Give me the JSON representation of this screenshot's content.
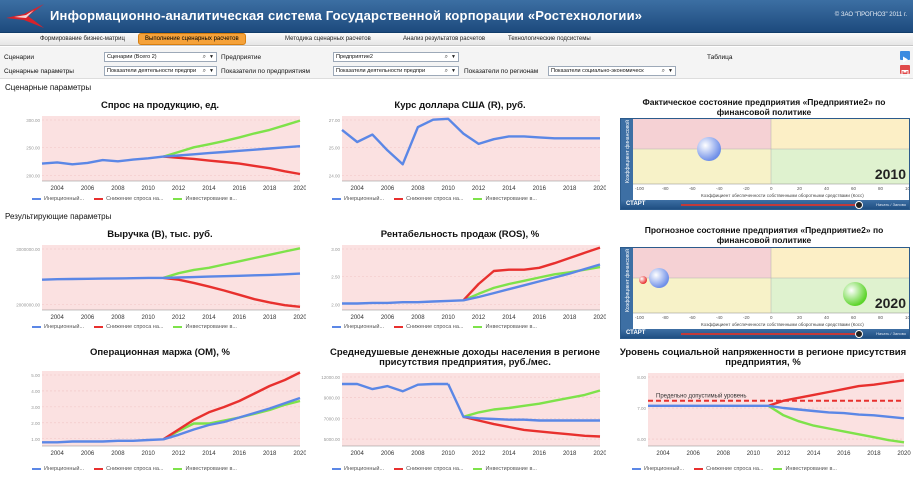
{
  "app": {
    "title": "Информационно-аналитическая система Государственной корпорации «Ростехнологии»",
    "copyright": "© ЗАО \"ПРОГНОЗ\" 2011 г."
  },
  "tabs": [
    {
      "label": "Формирование бизнес-матриц",
      "active": false
    },
    {
      "label": "Выполнение сценарных расчетов",
      "active": true
    },
    {
      "label": "Методика сценарных расчетов",
      "active": false
    },
    {
      "label": "Анализ результатов расчетов",
      "active": false
    },
    {
      "label": "Технологические подсистемы",
      "active": false
    }
  ],
  "filters": {
    "scenarios_label": "Сценарии",
    "scenarios_value": "Сценарии (Всего 2)",
    "enterprise_label": "Предприятие",
    "enterprise_value": "Предприятие2",
    "table_label": "Таблица",
    "scen_params_label": "Сценарные параметры",
    "scen_params_value": "Показатели деятельности предпри",
    "ent_params_label": "Показатели по предприятиям",
    "ent_params_value": "Показатели деятельности предпри",
    "reg_params_label": "Показатели по регионам",
    "reg_params_value": "Показатели социально-экономическ"
  },
  "sections": {
    "scenario": "Сценарные параметры",
    "result": "Результирующие параметры"
  },
  "legend": {
    "inertial": "Инерционный...",
    "decline": "Снижение спроса на...",
    "invest": "Инвестирование в..."
  },
  "colors": {
    "inertial": "#5b87e6",
    "decline": "#e8302e",
    "invest": "#7ee24a",
    "band": "#fbe1e1",
    "grid": "#f1c5c5",
    "header": "#2a5d93",
    "accent": "#f5a23a"
  },
  "chart_data": [
    {
      "id": "demand",
      "type": "line",
      "title": "Спрос на продукцию, ед.",
      "x": [
        2003,
        2004,
        2005,
        2006,
        2007,
        2008,
        2009,
        2010,
        2011,
        2012,
        2013,
        2014,
        2015,
        2016,
        2017,
        2018,
        2019,
        2020
      ],
      "ylim": [
        180,
        460
      ],
      "yticks": [
        "300.00",
        "250.00",
        "200.00"
      ],
      "xticks": [
        2004,
        2006,
        2008,
        2010,
        2012,
        2014,
        2016,
        2018,
        2020
      ],
      "series": [
        {
          "key": "inertial",
          "values": [
            255,
            260,
            252,
            258,
            270,
            265,
            272,
            278,
            285,
            290,
            295,
            300,
            305,
            310,
            315,
            320,
            325,
            330
          ]
        },
        {
          "key": "decline",
          "values": [
            null,
            null,
            null,
            null,
            null,
            null,
            null,
            null,
            285,
            280,
            275,
            268,
            262,
            255,
            245,
            235,
            222,
            210
          ]
        },
        {
          "key": "invest",
          "values": [
            null,
            null,
            null,
            null,
            null,
            null,
            null,
            null,
            285,
            305,
            325,
            338,
            352,
            368,
            385,
            400,
            420,
            440
          ]
        }
      ]
    },
    {
      "id": "usd",
      "type": "line",
      "title": "Курс доллара США (R), руб.",
      "x": [
        2003,
        2004,
        2005,
        2006,
        2007,
        2008,
        2009,
        2010,
        2011,
        2012,
        2013,
        2014,
        2015,
        2016,
        2017,
        2018,
        2019,
        2020
      ],
      "ylim": [
        23,
        30
      ],
      "yticks": [
        "27.00",
        "25.00",
        "24.00"
      ],
      "xticks": [
        2004,
        2006,
        2008,
        2010,
        2012,
        2014,
        2016,
        2018,
        2020
      ],
      "series": [
        {
          "key": "inertial",
          "values": [
            28.5,
            27.2,
            28.0,
            26.3,
            24.8,
            28.8,
            29.6,
            29.7,
            28.1,
            27.0,
            27.5,
            27.8,
            27.8,
            27.7,
            27.6,
            27.6,
            27.6,
            27.6
          ]
        }
      ]
    },
    {
      "id": "revenue",
      "type": "line",
      "title": "Выручка (В), тыс. руб.",
      "x": [
        2003,
        2004,
        2005,
        2006,
        2007,
        2008,
        2009,
        2010,
        2011,
        2012,
        2013,
        2014,
        2015,
        2016,
        2017,
        2018,
        2019,
        2020
      ],
      "ylim": [
        150,
        450
      ],
      "yticks": [
        "3000000.00",
        "2000000.00"
      ],
      "xticks": [
        2004,
        2006,
        2008,
        2010,
        2012,
        2014,
        2016,
        2018,
        2020
      ],
      "series": [
        {
          "key": "inertial",
          "values": [
            290,
            292,
            293,
            294,
            295,
            296,
            297,
            298,
            298,
            300,
            302,
            304,
            306,
            308,
            310,
            312,
            315,
            318
          ]
        },
        {
          "key": "decline",
          "values": [
            null,
            null,
            null,
            null,
            null,
            null,
            null,
            null,
            298,
            290,
            275,
            258,
            240,
            220,
            200,
            185,
            172,
            165
          ]
        },
        {
          "key": "invest",
          "values": [
            null,
            null,
            null,
            null,
            null,
            null,
            null,
            null,
            298,
            320,
            335,
            345,
            360,
            375,
            390,
            405,
            420,
            435
          ]
        }
      ]
    },
    {
      "id": "ros",
      "type": "line",
      "title": "Рентабельность продаж (ROS), %",
      "x": [
        2003,
        2004,
        2005,
        2006,
        2007,
        2008,
        2009,
        2010,
        2011,
        2012,
        2013,
        2014,
        2015,
        2016,
        2017,
        2018,
        2019,
        2020
      ],
      "ylim": [
        0,
        100
      ],
      "yticks": [
        "3.00",
        "2.50",
        "2.00"
      ],
      "xticks": [
        2004,
        2006,
        2008,
        2010,
        2012,
        2014,
        2016,
        2018,
        2020
      ],
      "series": [
        {
          "key": "inertial",
          "values": [
            10,
            10,
            11,
            11,
            12,
            12,
            13,
            14,
            15,
            20,
            26,
            32,
            38,
            44,
            50,
            56,
            63,
            70
          ]
        },
        {
          "key": "decline",
          "values": [
            null,
            null,
            null,
            null,
            null,
            null,
            null,
            null,
            15,
            40,
            60,
            62,
            62,
            65,
            72,
            80,
            88,
            96
          ]
        },
        {
          "key": "invest",
          "values": [
            null,
            null,
            null,
            null,
            null,
            null,
            null,
            null,
            15,
            25,
            34,
            40,
            45,
            50,
            55,
            58,
            62,
            66
          ]
        }
      ]
    },
    {
      "id": "om",
      "type": "line",
      "title": "Операционная маржа (ОМ), %",
      "x": [
        2003,
        2004,
        2005,
        2006,
        2007,
        2008,
        2009,
        2010,
        2011,
        2012,
        2013,
        2014,
        2015,
        2016,
        2017,
        2018,
        2019,
        2020
      ],
      "ylim": [
        0,
        100
      ],
      "yticks": [
        "5.00",
        "4.00",
        "3.00",
        "2.00",
        "1.00"
      ],
      "xticks": [
        2004,
        2006,
        2008,
        2010,
        2012,
        2014,
        2016,
        2018,
        2020
      ],
      "series": [
        {
          "key": "inertial",
          "values": [
            5,
            5,
            6,
            6,
            6,
            7,
            7,
            8,
            9,
            15,
            22,
            28,
            32,
            38,
            44,
            50,
            57,
            64
          ]
        },
        {
          "key": "decline",
          "values": [
            null,
            null,
            null,
            null,
            null,
            null,
            null,
            null,
            9,
            22,
            35,
            45,
            52,
            60,
            70,
            80,
            88,
            98
          ]
        },
        {
          "key": "invest",
          "values": [
            null,
            null,
            null,
            null,
            null,
            null,
            null,
            null,
            9,
            20,
            30,
            30,
            34,
            38,
            43,
            48,
            55,
            60
          ]
        }
      ]
    },
    {
      "id": "income",
      "type": "line",
      "title": "Среднедушевые денежные доходы населения в регионе присутствия предприятия, руб./мес.",
      "x": [
        2003,
        2004,
        2005,
        2006,
        2007,
        2008,
        2009,
        2010,
        2011,
        2012,
        2013,
        2014,
        2015,
        2016,
        2017,
        2018,
        2019,
        2020
      ],
      "ylim": [
        0,
        100
      ],
      "yticks": [
        "12000.00",
        "9000.00",
        "7000.00",
        "5000.00"
      ],
      "xticks": [
        2004,
        2006,
        2008,
        2010,
        2012,
        2014,
        2016,
        2018,
        2020
      ],
      "series": [
        {
          "key": "inertial",
          "values": [
            85,
            85,
            78,
            82,
            75,
            84,
            85,
            85,
            null,
            null,
            null,
            null,
            null,
            null,
            null,
            null,
            null,
            null
          ]
        },
        {
          "key": "inertial",
          "values": [
            null,
            null,
            null,
            null,
            null,
            null,
            null,
            85,
            40,
            38,
            37,
            36,
            36,
            35,
            35,
            35,
            35,
            35
          ]
        },
        {
          "key": "decline",
          "values": [
            null,
            null,
            null,
            null,
            null,
            null,
            null,
            null,
            40,
            35,
            30,
            26,
            22,
            20,
            18,
            16,
            14,
            13
          ]
        },
        {
          "key": "invest",
          "values": [
            null,
            null,
            null,
            null,
            null,
            null,
            null,
            null,
            40,
            46,
            50,
            52,
            55,
            58,
            62,
            66,
            70,
            76
          ]
        }
      ]
    },
    {
      "id": "tension",
      "type": "line",
      "title": "Уровень социальной напряженности в регионе присутствия предприятия, %",
      "x": [
        2003,
        2004,
        2005,
        2006,
        2007,
        2008,
        2009,
        2010,
        2011,
        2012,
        2013,
        2014,
        2015,
        2016,
        2017,
        2018,
        2019,
        2020
      ],
      "ylim": [
        0,
        100
      ],
      "yticks": [
        "8.00",
        "7.00",
        "6.00"
      ],
      "xticks": [
        2004,
        2006,
        2008,
        2010,
        2012,
        2014,
        2016,
        2018,
        2020
      ],
      "threshold": {
        "value": 62,
        "label": "Предельно допустимый уровень"
      },
      "series": [
        {
          "key": "inertial",
          "values": [
            55,
            55,
            55,
            55,
            55,
            55,
            55,
            55,
            55,
            52,
            50,
            48,
            46,
            45,
            43,
            42,
            40,
            38
          ]
        },
        {
          "key": "decline",
          "values": [
            null,
            null,
            null,
            null,
            null,
            null,
            null,
            null,
            55,
            62,
            66,
            70,
            74,
            78,
            82,
            84,
            87,
            90
          ]
        },
        {
          "key": "invest",
          "values": [
            null,
            null,
            null,
            null,
            null,
            null,
            null,
            null,
            55,
            42,
            34,
            28,
            24,
            20,
            16,
            12,
            8,
            5
          ]
        }
      ]
    }
  ],
  "panels": [
    {
      "title": "Фактическое состояние предприятия «Предприятие2» по финансовой политике",
      "year": "2010",
      "start": "СТАРТ",
      "xaxis": "Коэффициент обеспеченности собственными оборотными средствами (Косс)",
      "yaxis": "Коэффициент финансовой",
      "controls": "Начать / Заново",
      "xticks": [
        "-100",
        "-80",
        "-60",
        "-40",
        "-20",
        "0",
        "20",
        "40",
        "60",
        "80",
        "100"
      ]
    },
    {
      "title": "Прогнозное состояние предприятия «Предприятие2» по финансовой политике",
      "year": "2020",
      "start": "СТАРТ",
      "xaxis": "Коэффициент обеспеченности собственными оборотными средствами (Косс)",
      "yaxis": "Коэффициент финансовой",
      "controls": "Начать / Заново",
      "xticks": [
        "-100",
        "-80",
        "-60",
        "-40",
        "-20",
        "0",
        "20",
        "40",
        "60",
        "80",
        "100"
      ]
    }
  ]
}
